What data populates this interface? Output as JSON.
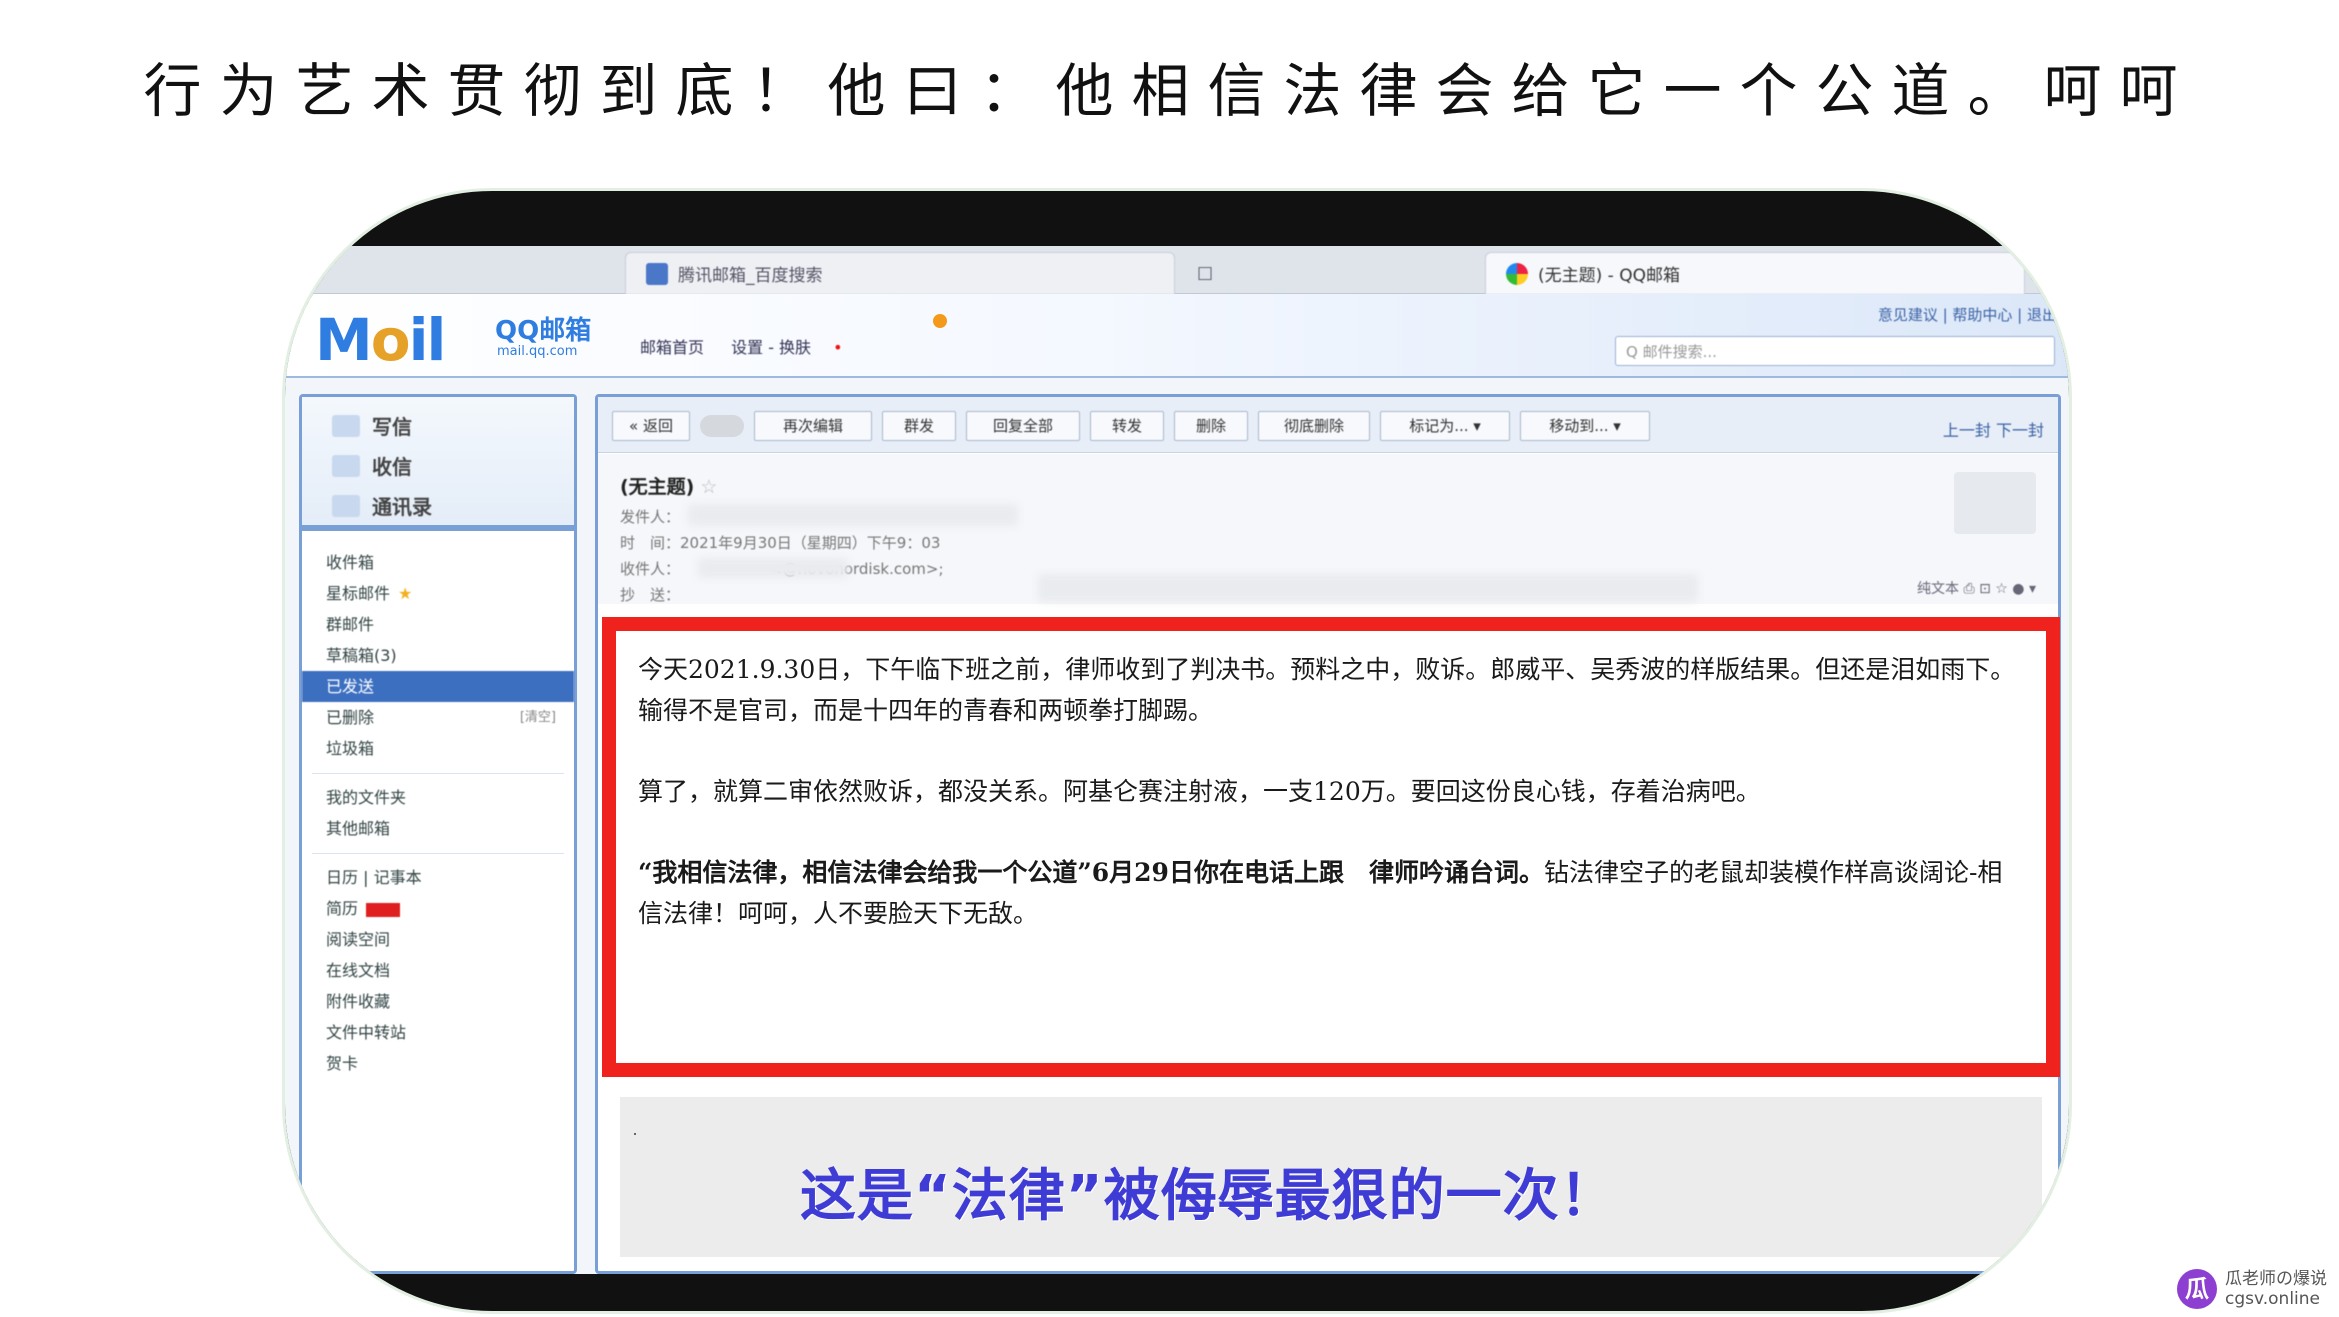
{
  "headline": "行为艺术贯彻到底！他曰：他相信法律会给它一个公道。呵呵",
  "browser": {
    "tab1_title": "腾讯邮箱_百度搜索",
    "tab2_title": "□",
    "tab3_title": "(无主题) - QQ邮箱"
  },
  "mail_header": {
    "logo": "M",
    "logo_o": "o",
    "logo_il": "il",
    "logo_sub": "QQ邮箱",
    "logo_url": "mail.qq.com",
    "link_home": "邮箱首页",
    "link_settings": "设置 - 换肤",
    "top_links": "意见建议 | 帮助中心 | 退出",
    "search_placeholder": "Q 邮件搜索..."
  },
  "sidebar": {
    "compose": "写信",
    "inbox_btn": "收信",
    "contacts": "通讯录",
    "items": [
      {
        "label": "收件箱"
      },
      {
        "label": "星标邮件"
      },
      {
        "label": "群邮件"
      },
      {
        "label": "草稿箱(3)"
      },
      {
        "label": "已发送"
      },
      {
        "label": "已删除",
        "note": "[清空]"
      },
      {
        "label": "垃圾箱"
      },
      {
        "label": "我的文件夹"
      },
      {
        "label": "其他邮箱"
      },
      {
        "label": "日历 | 记事本"
      },
      {
        "label": "简历"
      },
      {
        "label": "阅读空间"
      },
      {
        "label": "在线文档"
      },
      {
        "label": "附件收藏"
      },
      {
        "label": "文件中转站"
      },
      {
        "label": "贺卡"
      }
    ]
  },
  "toolbar": {
    "back": "« 返回",
    "reply": "再次编辑",
    "forward_label": "群发",
    "reply_all": "回复全部",
    "fwd": "转发",
    "delete": "删除",
    "perm_delete": "彻底删除",
    "mark_as": "标记为... ▾",
    "move_to": "移动到... ▾",
    "prev_next": "上一封 下一封"
  },
  "message": {
    "subject": "(无主题)",
    "from_label": "发件人：",
    "time_label": "时　间：2021年9月30日（星期四）下午9：03",
    "to_label": "收件人：",
    "to_value": "<@novonordisk.com>;",
    "cc_label": "抄　送：",
    "view_tools": "纯文本 ⎙ ⊡ ☆ ● ▾",
    "p1": "今天2021.9.30日，下午临下班之前，律师收到了判决书。预料之中，败诉。郎威平、吴秀波的样版结果。但还是泪如雨下。输得不是官司，而是十四年的青春和两顿拳打脚踢。",
    "p2": "算了，就算二审依然败诉，都没关系。阿基仑赛注射液，一支120万。要回这份良心钱，存着治病吧。",
    "p3_bold": "“我相信法律，相信法律会给我一个公道”6月29日你在电话上跟　律师吟诵台词。",
    "p3_rest": "钻法律空子的老鼠却装模作样高谈阔论-相信法律！呵呵，人不要脸天下无敌。"
  },
  "slogan": "这是“法律”被侮辱最狠的一次！",
  "watermark": {
    "icon": "瓜",
    "line1": "瓜老师の爆说",
    "line2": "cgsv.online"
  }
}
